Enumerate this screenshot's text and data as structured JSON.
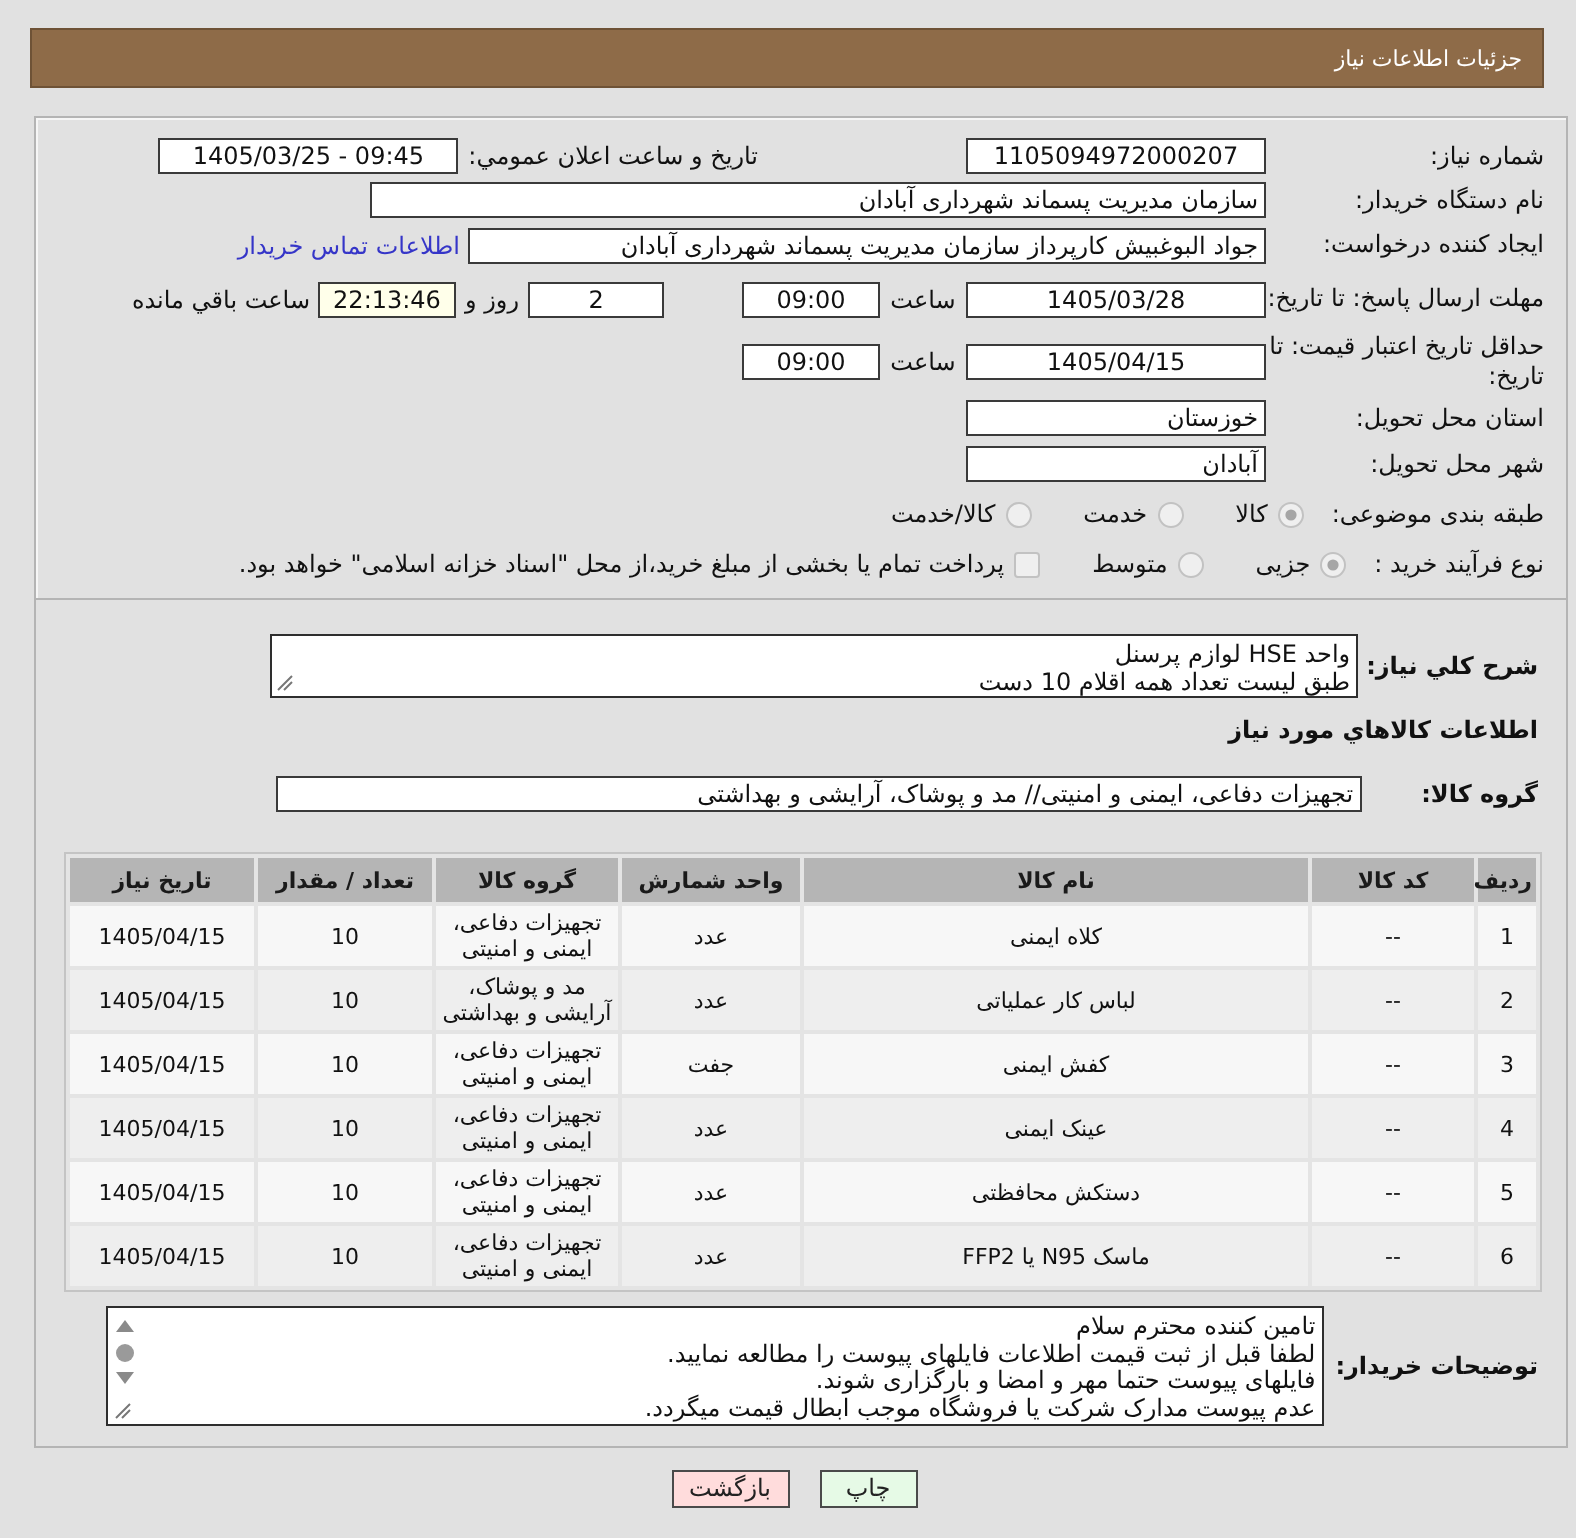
{
  "header": {
    "title": "جزئیات اطلاعات نیاز"
  },
  "need_number": {
    "label": "شماره نیاز:",
    "value": "1105094972000207"
  },
  "announcement": {
    "label": "تاریخ و ساعت اعلان عمومي:",
    "value": "1405/03/25 - 09:45"
  },
  "buyer_org": {
    "label": "نام دستگاه خریدار:",
    "value": "سازمان مدیریت پسماند شهرداری آبادان"
  },
  "requester": {
    "label": "ایجاد کننده درخواست:",
    "value": "جواد البوغبیش کارپرداز سازمان مدیریت پسماند شهرداری آبادان",
    "contact_link": "اطلاعات تماس خریدار"
  },
  "reply_deadline": {
    "label": "مهلت ارسال پاسخ: تا تاریخ:",
    "date": "1405/03/28",
    "time_label": "ساعت",
    "time": "09:00",
    "days": "2",
    "days_label": "روز و",
    "remaining": "22:13:46",
    "remaining_label": "ساعت باقي مانده"
  },
  "price_validity": {
    "label": "حداقل تاریخ اعتبار قیمت: تا تاریخ:",
    "date": "1405/04/15",
    "time_label": "ساعت",
    "time": "09:00"
  },
  "delivery_province": {
    "label": "استان محل تحویل:",
    "value": "خوزستان"
  },
  "delivery_city": {
    "label": "شهر محل تحویل:",
    "value": "آبادان"
  },
  "category": {
    "label": "طبقه بندی موضوعی:",
    "disabled": true,
    "options": [
      {
        "label": "کالا",
        "selected": true
      },
      {
        "label": "خدمت",
        "selected": false
      },
      {
        "label": "کالا/خدمت",
        "selected": false
      }
    ]
  },
  "purchase_type": {
    "label": "نوع فرآیند خرید :",
    "disabled": true,
    "options": [
      {
        "label": "جزیی",
        "selected": true
      },
      {
        "label": "متوسط",
        "selected": false
      }
    ],
    "treasury_bonds": {
      "label": "پرداخت تمام یا بخشی از مبلغ خرید،از محل \"اسناد خزانه اسلامی\" خواهد بود.",
      "checked": false,
      "disabled": true
    }
  },
  "description": {
    "label": "شرح کلي نياز:",
    "value": "واحد HSE لوازم پرسنل\nطبق لیست تعداد همه اقلام 10 دست"
  },
  "goods_heading": "اطلاعات کالاهاي مورد نياز",
  "goods_group": {
    "label": "گروه کالا:",
    "value": "تجهیزات دفاعی، ایمنی و امنیتی// مد و پوشاک، آرایشی و بهداشتی"
  },
  "table": {
    "columns": [
      "ردیف",
      "کد کالا",
      "نام کالا",
      "واحد شمارش",
      "گروه کالا",
      "تعداد / مقدار",
      "تاریخ نیاز"
    ],
    "rows": [
      [
        "1",
        "--",
        "کلاه ایمنی",
        "عدد",
        "تجهیزات دفاعی، ایمنی و امنیتی",
        "10",
        "1405/04/15"
      ],
      [
        "2",
        "--",
        "لباس کار عملیاتی",
        "عدد",
        "مد و پوشاک، آرایشی و بهداشتی",
        "10",
        "1405/04/15"
      ],
      [
        "3",
        "--",
        "کفش ایمنی",
        "جفت",
        "تجهیزات دفاعی، ایمنی و امنیتی",
        "10",
        "1405/04/15"
      ],
      [
        "4",
        "--",
        "عینک ایمنی",
        "عدد",
        "تجهیزات دفاعی، ایمنی و امنیتی",
        "10",
        "1405/04/15"
      ],
      [
        "5",
        "--",
        "دستکش محافظتی",
        "عدد",
        "تجهیزات دفاعی، ایمنی و امنیتی",
        "10",
        "1405/04/15"
      ],
      [
        "6",
        "--",
        "ماسک N95 یا FFP2",
        "عدد",
        "تجهیزات دفاعی، ایمنی و امنیتی",
        "10",
        "1405/04/15"
      ]
    ]
  },
  "buyer_notes": {
    "label": "توضیحات خریدار:",
    "value": "تامین کننده محترم سلام\nلطفا قبل از ثبت قیمت اطلاعات فایلهای پیوست را مطالعه نمایید.\nفایلهای پیوست حتما مهر و امضا و بارگزاری شوند.\nعدم پیوست مدارک شرکت یا فروشگاه موجب ابطال قیمت میگردد."
  },
  "buttons": [
    {
      "label": "چاپ",
      "kind": "print"
    },
    {
      "label": "بازگشت",
      "kind": "back"
    }
  ]
}
